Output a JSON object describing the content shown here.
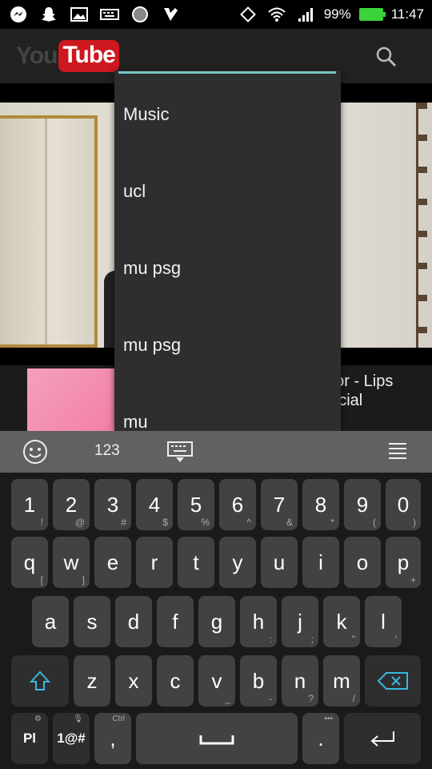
{
  "status_bar": {
    "battery": "99%",
    "time": "11:47",
    "icons": [
      "messenger-icon",
      "snapchat-icon",
      "image-icon",
      "keyboard-icon",
      "circle-icon",
      "check-app-icon",
      "rotate-icon",
      "wifi-icon",
      "signal-icon",
      "battery-icon"
    ]
  },
  "app_bar": {
    "logo_you": "You",
    "logo_tube": "Tube",
    "search_value": ""
  },
  "suggestions": [
    "Music",
    "ucl",
    "mu psg",
    "mu psg",
    "mu"
  ],
  "video_row": {
    "title": "nor - Lips\nfficial"
  },
  "keyboard_toolbar": {
    "numbers_label": "123"
  },
  "keyboard": {
    "row1": [
      {
        "main": "1",
        "sub": "!"
      },
      {
        "main": "2",
        "sub": "@"
      },
      {
        "main": "3",
        "sub": "#"
      },
      {
        "main": "4",
        "sub": "$"
      },
      {
        "main": "5",
        "sub": "%"
      },
      {
        "main": "6",
        "sub": "^"
      },
      {
        "main": "7",
        "sub": "&"
      },
      {
        "main": "8",
        "sub": "*"
      },
      {
        "main": "9",
        "sub": "("
      },
      {
        "main": "0",
        "sub": ")"
      }
    ],
    "row2": [
      {
        "main": "q",
        "sub": "["
      },
      {
        "main": "w",
        "sub": "]"
      },
      {
        "main": "e",
        "sub": ""
      },
      {
        "main": "r",
        "sub": ""
      },
      {
        "main": "t",
        "sub": ""
      },
      {
        "main": "y",
        "sub": ""
      },
      {
        "main": "u",
        "sub": ""
      },
      {
        "main": "i",
        "sub": ""
      },
      {
        "main": "o",
        "sub": ""
      },
      {
        "main": "p",
        "sub": "+"
      }
    ],
    "row3": [
      {
        "main": "a",
        "sub": ""
      },
      {
        "main": "s",
        "sub": ""
      },
      {
        "main": "d",
        "sub": ""
      },
      {
        "main": "f",
        "sub": ""
      },
      {
        "main": "g",
        "sub": ""
      },
      {
        "main": "h",
        "sub": ":"
      },
      {
        "main": "j",
        "sub": ";"
      },
      {
        "main": "k",
        "sub": "\""
      },
      {
        "main": "l",
        "sub": "'"
      }
    ],
    "row4": [
      {
        "main": "z",
        "sub": ""
      },
      {
        "main": "x",
        "sub": ""
      },
      {
        "main": "c",
        "sub": ""
      },
      {
        "main": "v",
        "sub": "_"
      },
      {
        "main": "b",
        "sub": "-"
      },
      {
        "main": "n",
        "sub": "?"
      },
      {
        "main": "m",
        "sub": "/"
      }
    ],
    "lang_label": "Pl",
    "symbols_label": "1@#",
    "comma_label": ",",
    "ctrl_label": "Ctrl",
    "period_label": ".",
    "period_top": "•••"
  }
}
